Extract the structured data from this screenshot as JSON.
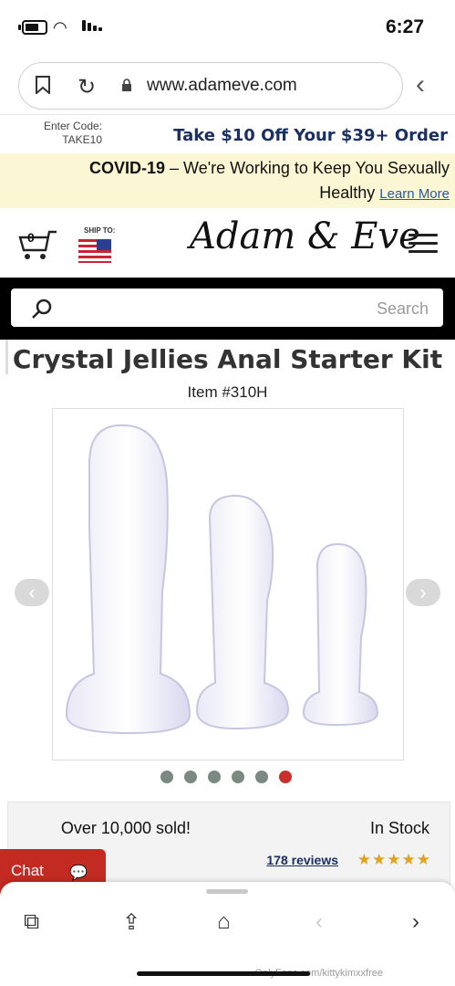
{
  "status": {
    "time": "6:27"
  },
  "browser": {
    "url": "www.adameve.com"
  },
  "promo": {
    "main": "Take $10 Off Your $39+ Order",
    "code_label": "Enter Code:",
    "code": "TAKE10"
  },
  "covid": {
    "bold": "COVID-19",
    "text": " – We're Working to Keep You Sexually",
    "text2": "Healthy ",
    "link": "Learn More"
  },
  "header": {
    "logo": "Adam & Eve",
    "ship_to": "SHIP TO:",
    "cart_count": "0"
  },
  "search": {
    "placeholder": "Search"
  },
  "product": {
    "title": "Crystal Jellies Anal Starter Kit",
    "item": "Item #310H",
    "image_count": 6,
    "active_image": 6
  },
  "info": {
    "stock": "In Stock",
    "sold": "Over 10,000 sold!",
    "rating": 4.5,
    "reviews": "178 reviews"
  },
  "chat": {
    "label": "Chat"
  },
  "watermark": "OnlyFans.com/kittykimxxfree",
  "colors": {
    "brand_navy": "#1b2f63",
    "brand_red": "#c22a22",
    "banner_yellow": "#fbf6d3"
  }
}
